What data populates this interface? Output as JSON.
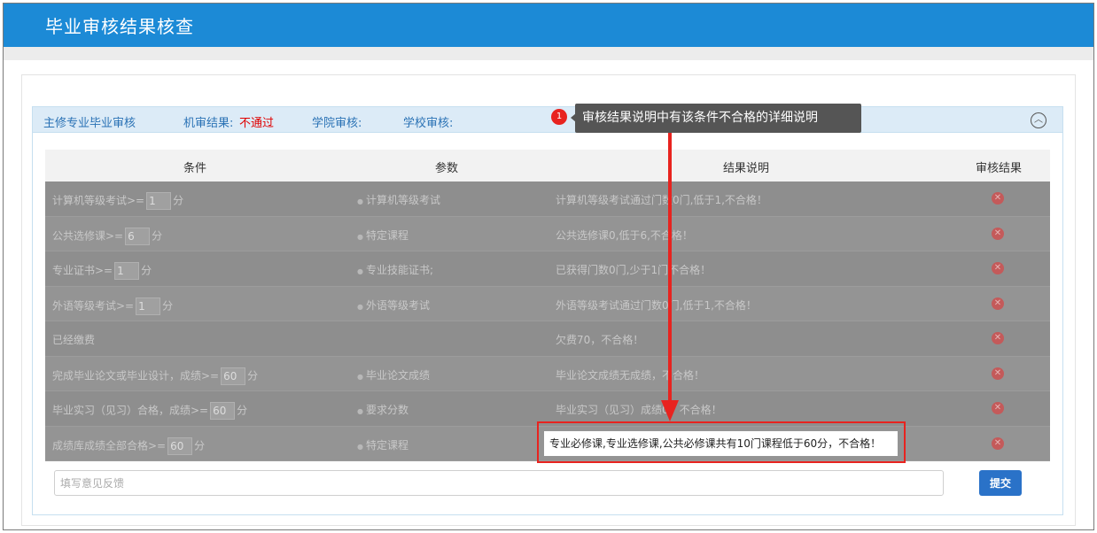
{
  "header": {
    "title": "毕业审核结果核查"
  },
  "panel": {
    "title": "主修专业毕业审核",
    "machine_label": "机审结果:",
    "machine_value": "不通过",
    "college_label": "学院审核:",
    "school_label": "学校审核:"
  },
  "table": {
    "headers": [
      "条件",
      "参数",
      "结果说明",
      "审核结果"
    ],
    "rows": [
      {
        "pre": "计算机等级考试>=",
        "num": "1",
        "post": "分",
        "param": "计算机等级考试",
        "result": "计算机等级考试通过门数0门,低于1,不合格！"
      },
      {
        "pre": "公共选修课>=",
        "num": "6",
        "post": "分",
        "param": "特定课程",
        "result": "公共选修课0,低于6,不合格！"
      },
      {
        "pre": "专业证书>=",
        "num": "1",
        "post": "分",
        "param": "专业技能证书;",
        "result": "已获得门数0门,少于1门不合格！"
      },
      {
        "pre": "外语等级考试>=",
        "num": "1",
        "post": "分",
        "param": "外语等级考试",
        "result": "外语等级考试通过门数0门,低于1,不合格！"
      },
      {
        "pre": "已经缴费",
        "num": "",
        "post": "",
        "param": "",
        "result": "欠费70，不合格！"
      },
      {
        "pre": "完成毕业论文或毕业设计，成绩>=",
        "num": "60",
        "post": "分",
        "param": "毕业论文成绩",
        "result": "毕业论文成绩无成绩，不合格！"
      },
      {
        "pre": "毕业实习（见习）合格，成绩>=",
        "num": "60",
        "post": "分",
        "param": "要求分数",
        "result": "毕业实习（见习）成绩0，不合格！"
      },
      {
        "pre": "成绩库成绩全部合格>=",
        "num": "60",
        "post": "分",
        "param": "特定课程",
        "result": ""
      }
    ]
  },
  "feedback": {
    "placeholder": "填写意见反馈"
  },
  "submit_label": "提交",
  "annotation": {
    "marker": "1",
    "callout": "审核结果说明中有该条件不合格的详细说明",
    "highlight_text": "专业必修课,专业选修课,公共必修课共有10门课程低于60分，不合格！",
    "accent_color": "#e8231f"
  },
  "colors": {
    "header_bg": "#1c8ad6",
    "panel_head_bg": "#dcebf7",
    "fail_text": "#e00000"
  }
}
